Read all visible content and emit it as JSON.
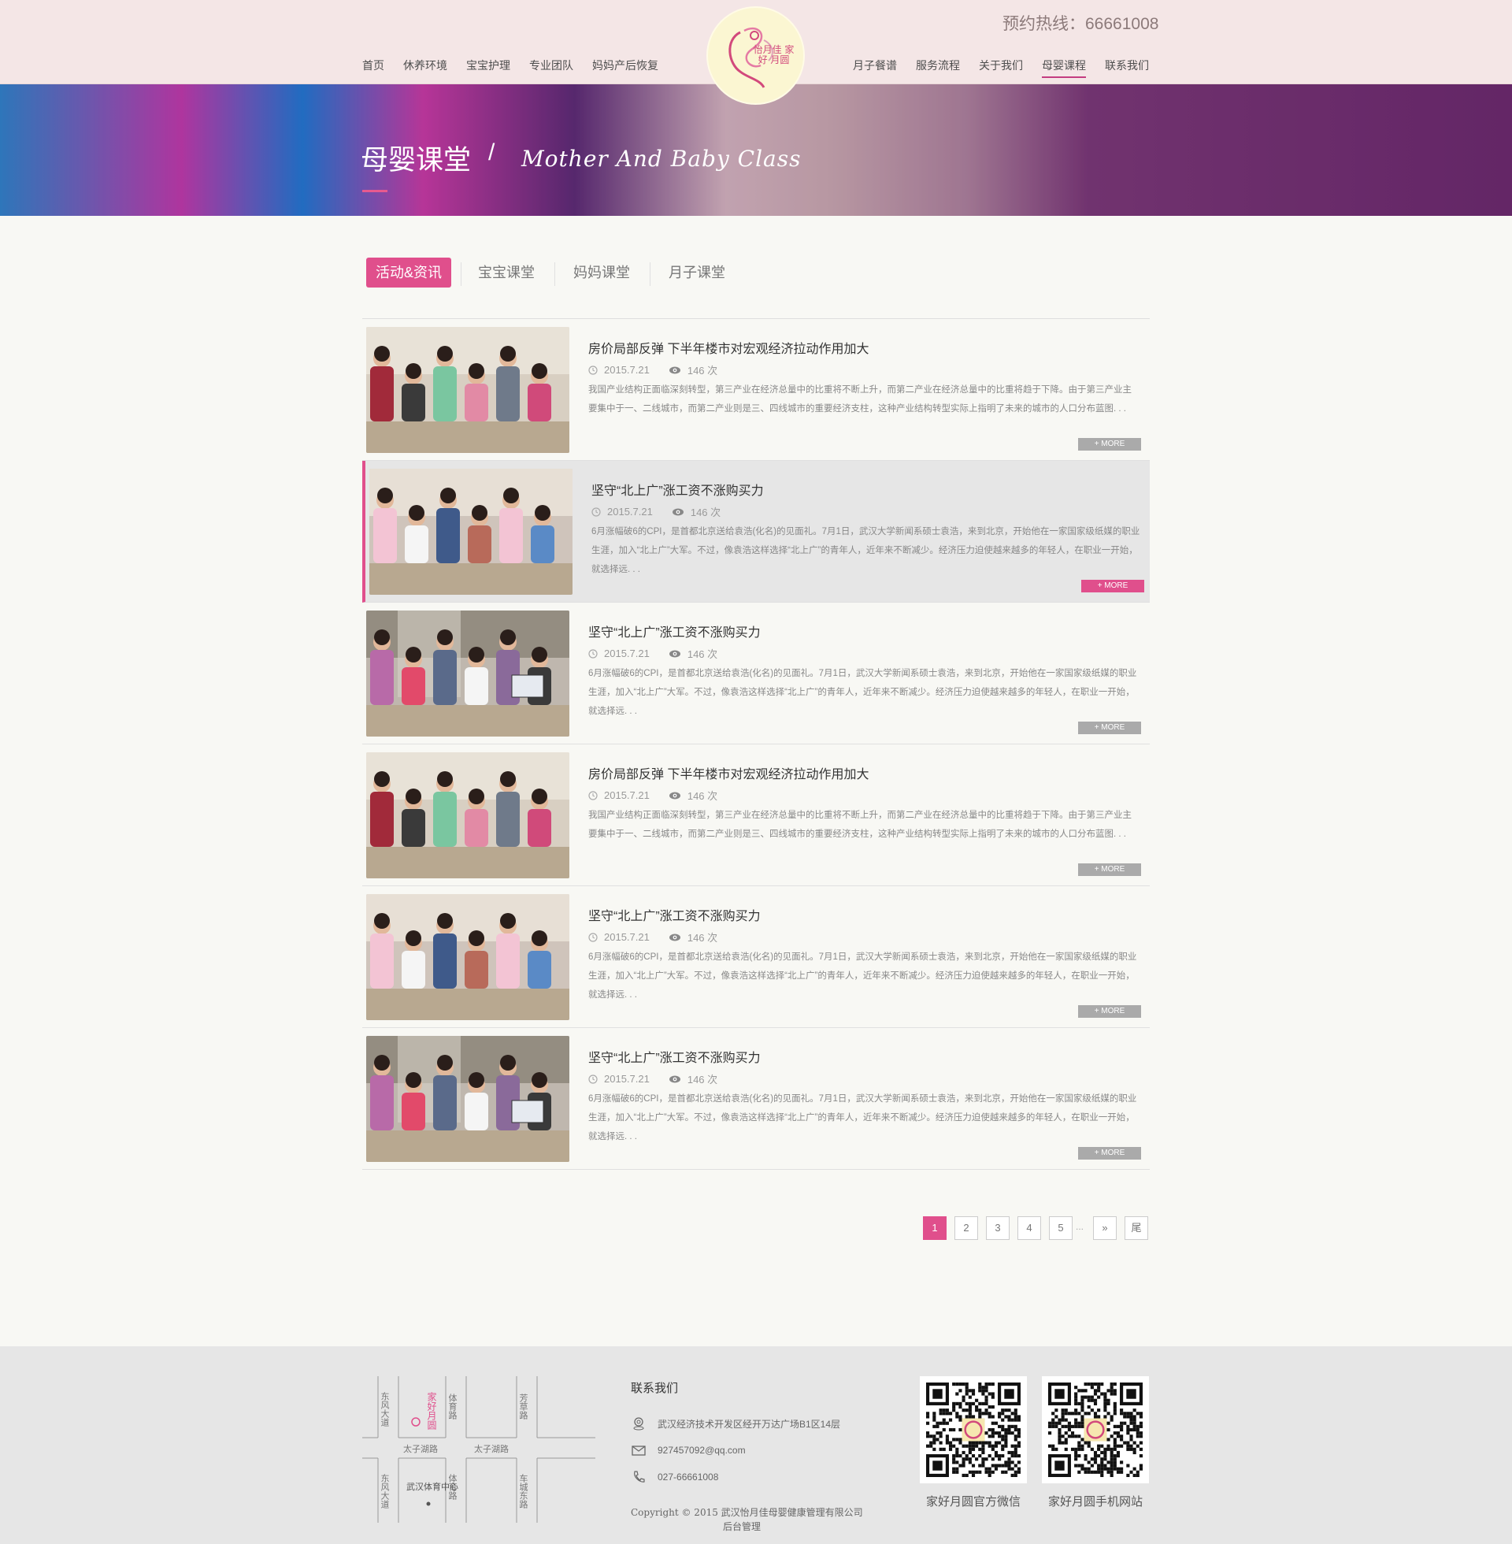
{
  "header": {
    "hotline": "预约热线：66661008",
    "nav_left": [
      "首页",
      "休养环境",
      "宝宝护理",
      "专业团队",
      "妈妈产后恢复"
    ],
    "nav_right": [
      "月子餐谱",
      "服务流程",
      "关于我们",
      "母婴课程",
      "联系我们"
    ],
    "active_nav": "母婴课程",
    "logo_text": "怡月佳 家好 月圆"
  },
  "banner": {
    "title": "母婴课堂",
    "separator": "/",
    "subtitle": "Mother And Baby Class"
  },
  "tabs": [
    {
      "label": "活动&资讯",
      "active": true
    },
    {
      "label": "宝宝课堂",
      "active": false
    },
    {
      "label": "妈妈课堂",
      "active": false
    },
    {
      "label": "月子课堂",
      "active": false
    }
  ],
  "items": [
    {
      "title": "房价局部反弹 下半年楼市对宏观经济拉动作用加大",
      "date": "2015.7.21",
      "views": "146 次",
      "desc": "我国产业结构正面临深刻转型，第三产业在经济总量中的比重将不断上升，而第二产业在经济总量中的比重将趋于下降。由于第三产业主要集中于一、二线城市，而第二产业则是三、四线城市的重要经济支柱，这种产业结构转型实际上指明了未来的城市的人口分布蓝图. . .",
      "more": "+ MORE"
    },
    {
      "title": "坚守“北上广”涨工资不涨购买力",
      "date": "2015.7.21",
      "views": "146 次",
      "desc": "6月涨幅破6的CPI，是首都北京送给袁浩(化名)的见面礼。7月1日，武汉大学新闻系硕士袁浩，来到北京，开始他在一家国家级纸媒的职业生涯，加入“北上广”大军。不过，像袁浩这样选择“北上广”的青年人，近年来不断减少。经济压力迫使越来越多的年轻人，在职业一开始，就选择远. . .",
      "more": "+ MORE"
    },
    {
      "title": "坚守“北上广”涨工资不涨购买力",
      "date": "2015.7.21",
      "views": "146 次",
      "desc": "6月涨幅破6的CPI，是首都北京送给袁浩(化名)的见面礼。7月1日，武汉大学新闻系硕士袁浩，来到北京，开始他在一家国家级纸媒的职业生涯，加入“北上广”大军。不过，像袁浩这样选择“北上广”的青年人，近年来不断减少。经济压力迫使越来越多的年轻人，在职业一开始，就选择远. . .",
      "more": "+ MORE"
    },
    {
      "title": "房价局部反弹 下半年楼市对宏观经济拉动作用加大",
      "date": "2015.7.21",
      "views": "146 次",
      "desc": "我国产业结构正面临深刻转型，第三产业在经济总量中的比重将不断上升，而第二产业在经济总量中的比重将趋于下降。由于第三产业主要集中于一、二线城市，而第二产业则是三、四线城市的重要经济支柱，这种产业结构转型实际上指明了未来的城市的人口分布蓝图. . .",
      "more": "+ MORE"
    },
    {
      "title": "坚守“北上广”涨工资不涨购买力",
      "date": "2015.7.21",
      "views": "146 次",
      "desc": "6月涨幅破6的CPI，是首都北京送给袁浩(化名)的见面礼。7月1日，武汉大学新闻系硕士袁浩，来到北京，开始他在一家国家级纸媒的职业生涯，加入“北上广”大军。不过，像袁浩这样选择“北上广”的青年人，近年来不断减少。经济压力迫使越来越多的年轻人，在职业一开始，就选择远. . .",
      "more": "+ MORE"
    },
    {
      "title": "坚守“北上广”涨工资不涨购买力",
      "date": "2015.7.21",
      "views": "146 次",
      "desc": "6月涨幅破6的CPI，是首都北京送给袁浩(化名)的见面礼。7月1日，武汉大学新闻系硕士袁浩，来到北京，开始他在一家国家级纸媒的职业生涯，加入“北上广”大军。不过，像袁浩这样选择“北上广”的青年人，近年来不断减少。经济压力迫使越来越多的年轻人，在职业一开始，就选择远. . .",
      "more": "+ MORE"
    }
  ],
  "pagination": {
    "pages": [
      "1",
      "2",
      "3",
      "4",
      "5"
    ],
    "dots": "...",
    "next": "»",
    "last": "尾",
    "current": "1"
  },
  "footer": {
    "map_labels": {
      "road1": "东风大道",
      "road1b": "东风大道",
      "place": "家好月圆",
      "road2": "体育路",
      "road2b": "体育路",
      "road3": "芳草路",
      "road4": "太子湖路",
      "road4b": "太子湖路",
      "center": "武汉体育中心",
      "road5": "车城东路"
    },
    "contact_title": "联系我们",
    "address": "武汉经济技术开发区经开万达广场B1区14层",
    "email": "927457092@qq.com",
    "phone": "027-66661008",
    "copyright": "Copyright © 2015   武汉怡月佳母婴健康管理有限公司",
    "admin": "后台管理",
    "qr1_label": "家好月圆官方微信",
    "qr2_label": "家好月圆手机网站"
  },
  "colors": {
    "accent": "#e04f8c",
    "header_bg": "#f4e6e6",
    "page_bg": "#f8f8f4",
    "footer_bg": "#e6e6e6"
  }
}
